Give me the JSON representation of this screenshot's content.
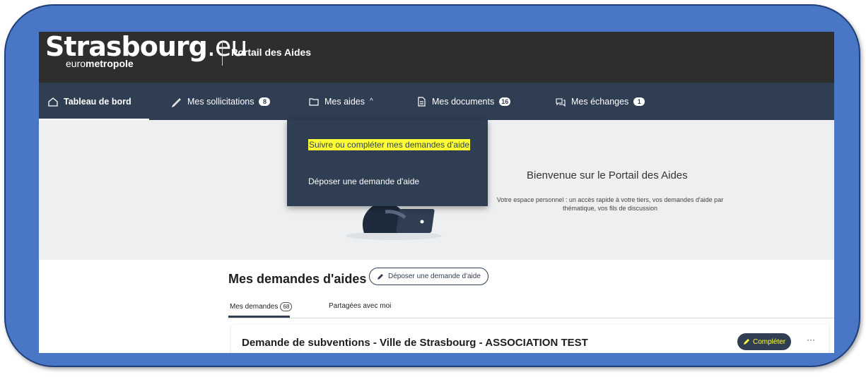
{
  "brand": {
    "logo_main": "Strasbourg",
    "logo_tld": ".eu",
    "logo_sub_prefix": "euro",
    "logo_sub_bold": "metropole",
    "title": "Portail des Aides"
  },
  "nav": {
    "items": [
      {
        "label": "Tableau de bord",
        "icon": "home-icon"
      },
      {
        "label": "Mes sollicitations",
        "icon": "pen-icon",
        "badge": "8"
      },
      {
        "label": "Mes aides",
        "icon": "folder-icon"
      },
      {
        "label": "Mes documents",
        "icon": "document-icon",
        "badge": "16"
      },
      {
        "label": "Mes échanges",
        "icon": "chat-icon",
        "badge": "1"
      }
    ],
    "chevron": "^"
  },
  "dropdown": {
    "items": [
      {
        "label": "Suivre ou compléter mes demandes d'aide",
        "highlighted": true
      },
      {
        "label": "Déposer une demande d'aide"
      }
    ],
    "highlight_color": "#ffff33"
  },
  "hero": {
    "title": "Bienvenue sur le Portail des Aides",
    "description": "Votre espace personnel : un accès rapide à votre tiers, vos demandes d'aide par thématique, vos fils de discussion"
  },
  "requests": {
    "title": "Mes demandes d'aides",
    "new_button": "Déposer une demande d'aide",
    "tabs": [
      {
        "label": "Mes demandes",
        "count": "68"
      },
      {
        "label": "Partagées avec moi"
      }
    ],
    "card": {
      "title": "Demande de subventions - Ville de Strasbourg - ASSOCIATION TEST",
      "action": "Compléter",
      "more": "···"
    }
  },
  "colors": {
    "frame": "#4a76c6",
    "brandbar": "#2e2e2e",
    "navbar": "#2f3e52",
    "accent_yellow": "#ffff33"
  }
}
